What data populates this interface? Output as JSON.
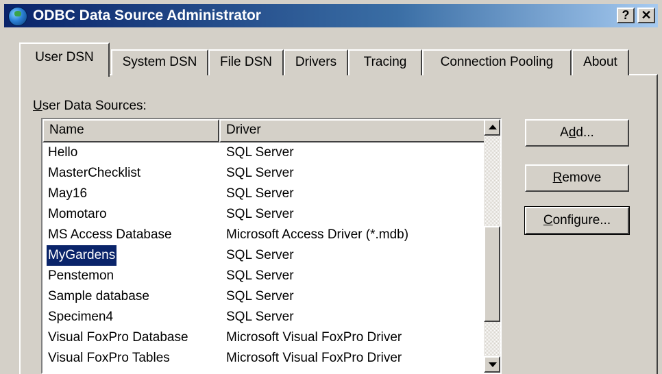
{
  "window": {
    "title": "ODBC Data Source Administrator",
    "help_glyph": "?",
    "close_glyph": "✕"
  },
  "tabs": [
    {
      "label": "User DSN",
      "active": true
    },
    {
      "label": "System DSN"
    },
    {
      "label": "File DSN"
    },
    {
      "label": "Drivers"
    },
    {
      "label": "Tracing"
    },
    {
      "label": "Connection Pooling"
    },
    {
      "label": "About"
    }
  ],
  "section_label": "User Data Sources:",
  "list": {
    "headers": {
      "name": "Name",
      "driver": "Driver"
    },
    "rows": [
      {
        "name": "Hello",
        "driver": "SQL Server"
      },
      {
        "name": "MasterChecklist",
        "driver": "SQL Server"
      },
      {
        "name": "May16",
        "driver": "SQL Server"
      },
      {
        "name": "Momotaro",
        "driver": "SQL Server"
      },
      {
        "name": "MS Access Database",
        "driver": "Microsoft Access Driver (*.mdb)"
      },
      {
        "name": "MyGardens",
        "driver": "SQL Server",
        "selected": true
      },
      {
        "name": "Penstemon",
        "driver": "SQL Server"
      },
      {
        "name": "Sample database",
        "driver": "SQL Server"
      },
      {
        "name": "Specimen4",
        "driver": "SQL Server"
      },
      {
        "name": "Visual FoxPro Database",
        "driver": "Microsoft Visual FoxPro Driver"
      },
      {
        "name": "Visual FoxPro Tables",
        "driver": "Microsoft Visual FoxPro Driver"
      }
    ]
  },
  "buttons": {
    "add": "Add...",
    "remove": "Remove",
    "configure": "Configure..."
  }
}
